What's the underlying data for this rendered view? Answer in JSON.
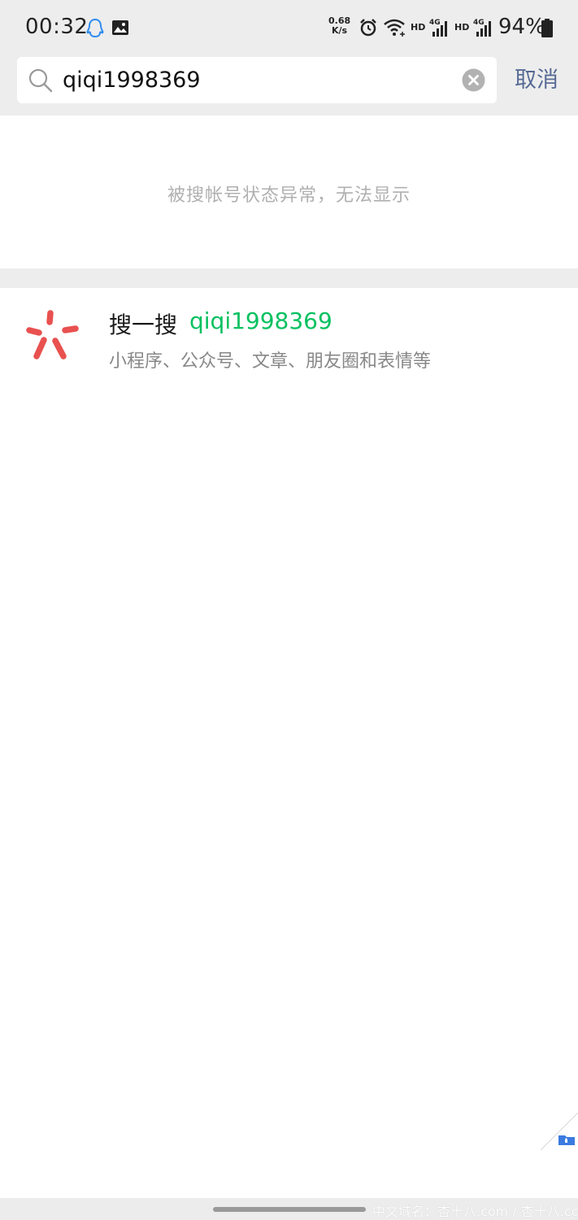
{
  "status_bar": {
    "time": "00:32",
    "net_speed_value": "0.68",
    "net_speed_unit": "K/s",
    "hd_label_1": "HD",
    "network_type_1": "4G",
    "hd_label_2": "HD",
    "network_type_2": "4G",
    "battery_percent": "94%",
    "icons": [
      "qq-icon",
      "gallery-icon",
      "alarm-icon",
      "wifi-icon",
      "signal-icon",
      "signal-icon",
      "battery-icon"
    ]
  },
  "search": {
    "query": "qiqi1998369",
    "cancel_label": "取消"
  },
  "notice": {
    "text": "被搜帐号状态异常，无法显示"
  },
  "search_one": {
    "label": "搜一搜",
    "query": "qiqi1998369",
    "subtitle": "小程序、公众号、文章、朋友圈和表情等",
    "icon": "search-one-icon"
  },
  "watermark": {
    "text": "中文域名：杏十八.com / 杏十八.cc"
  },
  "colors": {
    "accent_green": "#07c160",
    "link_blue": "#576b95",
    "logo_red": "#e8514f",
    "background_gray": "#ededed"
  }
}
